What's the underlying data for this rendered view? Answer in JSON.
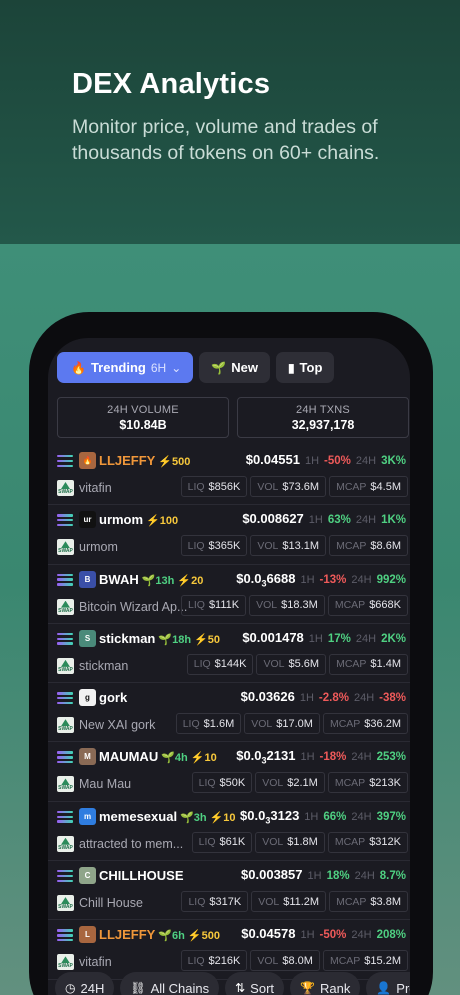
{
  "promo": {
    "headline": "DEX Analytics",
    "subline": "Monitor price, volume and trades of thousands of tokens on 60+ chains."
  },
  "tabs": {
    "trending": "Trending",
    "trending_period": "6H",
    "new": "New",
    "top": "Top"
  },
  "stats": {
    "volume_label": "24H VOLUME",
    "volume_value": "$10.84B",
    "txns_label": "24H TXNS",
    "txns_value": "32,937,178"
  },
  "labels": {
    "tf1": "1H",
    "tf24": "24H",
    "liq": "LIQ",
    "vol": "VOL",
    "mcap": "MCAP"
  },
  "tokens": [
    {
      "symbol": "LLJEFFY",
      "symbol_color": "#f0973a",
      "age": "",
      "boost": "⚡500",
      "name": "vitafin",
      "price_main": "$0.04551",
      "price_zeros": "",
      "price_tail": "",
      "ch1h": "-50%",
      "ch1h_dir": "neg",
      "ch24h": "3K%",
      "ch24h_dir": "pos",
      "liq": "$856K",
      "vol": "$73.6M",
      "mcap": "$4.5M",
      "avatar_bg": "#a8663f",
      "avatar_text": "🔥"
    },
    {
      "symbol": "urmom",
      "symbol_color": "#ffffff",
      "age": "",
      "boost": "⚡100",
      "name": "urmom",
      "price_main": "$0.008627",
      "price_zeros": "",
      "price_tail": "",
      "ch1h": "63%",
      "ch1h_dir": "pos",
      "ch24h": "1K%",
      "ch24h_dir": "pos",
      "liq": "$365K",
      "vol": "$13.1M",
      "mcap": "$8.6M",
      "avatar_bg": "#111111",
      "avatar_text": "ur"
    },
    {
      "symbol": "BWAH",
      "symbol_color": "#ffffff",
      "age": "13h",
      "boost": "⚡20",
      "name": "Bitcoin Wizard Ap...",
      "price_main": "$0.0",
      "price_zeros": "3",
      "price_tail": "6688",
      "ch1h": "-13%",
      "ch1h_dir": "neg",
      "ch24h": "992%",
      "ch24h_dir": "pos",
      "liq": "$111K",
      "vol": "$18.3M",
      "mcap": "$668K",
      "avatar_bg": "#3a4fa8",
      "avatar_text": "B"
    },
    {
      "symbol": "stickman",
      "symbol_color": "#ffffff",
      "age": "18h",
      "boost": "⚡50",
      "name": "stickman",
      "price_main": "$0.001478",
      "price_zeros": "",
      "price_tail": "",
      "ch1h": "17%",
      "ch1h_dir": "pos",
      "ch24h": "2K%",
      "ch24h_dir": "pos",
      "liq": "$144K",
      "vol": "$5.6M",
      "mcap": "$1.4M",
      "avatar_bg": "#4a8a7a",
      "avatar_text": "S"
    },
    {
      "symbol": "gork",
      "symbol_color": "#ffffff",
      "age": "",
      "boost": "",
      "name": "New XAI gork",
      "price_main": "$0.03626",
      "price_zeros": "",
      "price_tail": "",
      "ch1h": "-2.8%",
      "ch1h_dir": "neg",
      "ch24h": "-38%",
      "ch24h_dir": "neg",
      "liq": "$1.6M",
      "vol": "$17.0M",
      "mcap": "$36.2M",
      "avatar_bg": "#f2f2f2",
      "avatar_text": "g"
    },
    {
      "symbol": "MAUMAU",
      "symbol_color": "#ffffff",
      "age": "4h",
      "boost": "⚡10",
      "name": "Mau Mau",
      "price_main": "$0.0",
      "price_zeros": "3",
      "price_tail": "2131",
      "ch1h": "-18%",
      "ch1h_dir": "neg",
      "ch24h": "253%",
      "ch24h_dir": "pos",
      "liq": "$50K",
      "vol": "$2.1M",
      "mcap": "$213K",
      "avatar_bg": "#8a6a55",
      "avatar_text": "M"
    },
    {
      "symbol": "memesexual",
      "symbol_color": "#ffffff",
      "age": "3h",
      "boost": "⚡10",
      "name": "attracted to mem...",
      "price_main": "$0.0",
      "price_zeros": "3",
      "price_tail": "3123",
      "ch1h": "66%",
      "ch1h_dir": "pos",
      "ch24h": "397%",
      "ch24h_dir": "pos",
      "liq": "$61K",
      "vol": "$1.8M",
      "mcap": "$312K",
      "avatar_bg": "#2f7de0",
      "avatar_text": "m"
    },
    {
      "symbol": "CHILLHOUSE",
      "symbol_color": "#ffffff",
      "age": "",
      "boost": "",
      "name": "Chill House",
      "price_main": "$0.003857",
      "price_zeros": "",
      "price_tail": "",
      "ch1h": "18%",
      "ch1h_dir": "pos",
      "ch24h": "8.7%",
      "ch24h_dir": "pos",
      "liq": "$317K",
      "vol": "$11.2M",
      "mcap": "$3.8M",
      "avatar_bg": "#8fa58a",
      "avatar_text": "C"
    },
    {
      "symbol": "LLJEFFY",
      "symbol_color": "#f0973a",
      "age": "6h",
      "boost": "⚡500",
      "name": "vitafin",
      "price_main": "$0.04578",
      "price_zeros": "",
      "price_tail": "",
      "ch1h": "-50%",
      "ch1h_dir": "neg",
      "ch24h": "208%",
      "ch24h_dir": "pos",
      "liq": "$216K",
      "vol": "$8.0M",
      "mcap": "$15.2M",
      "avatar_bg": "#a8663f",
      "avatar_text": "L"
    }
  ],
  "bottombar": {
    "period": "24H",
    "chains": "All Chains",
    "sort": "Sort",
    "rank": "Rank",
    "profile": "Profile"
  },
  "icons": {
    "trending": "flame-icon",
    "new": "sprout-icon",
    "top": "bar-chart-icon",
    "period": "clock-icon",
    "chains": "link-icon",
    "sort": "sort-arrows-icon",
    "rank": "trophy-icon",
    "profile": "user-icon"
  },
  "colors": {
    "accent": "#5c79f0",
    "positive": "#4fd082",
    "negative": "#ef5a5a",
    "boost": "#f7c83c"
  }
}
